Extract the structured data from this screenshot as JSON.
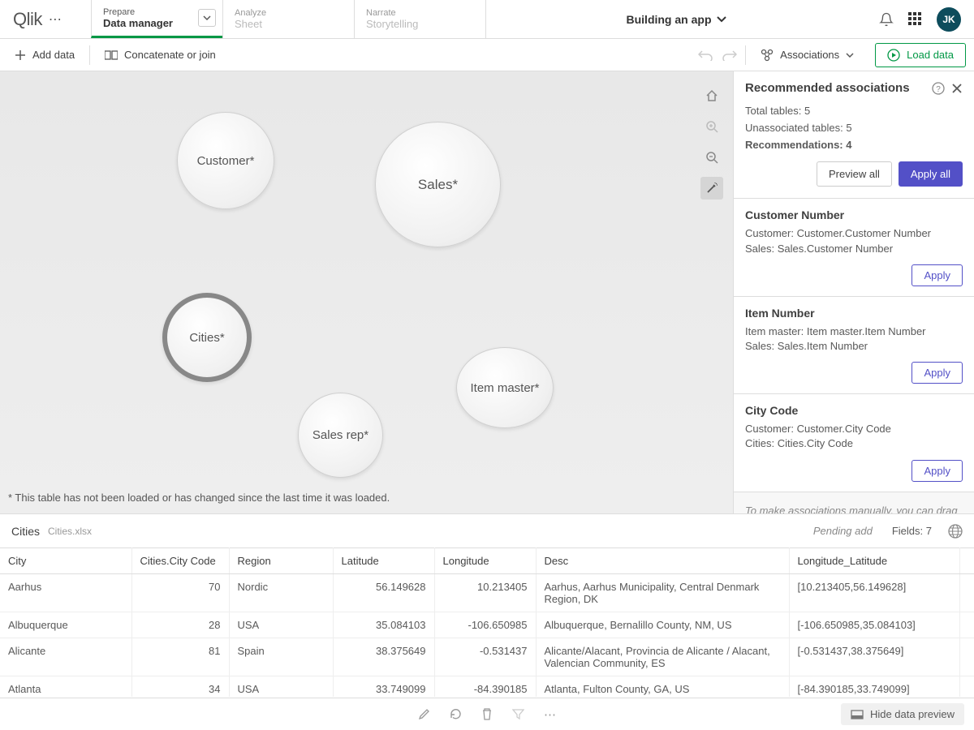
{
  "logo": "Qlik",
  "nav": {
    "prepare": {
      "top": "Prepare",
      "bottom": "Data manager"
    },
    "analyze": {
      "top": "Analyze",
      "bottom": "Sheet"
    },
    "narrate": {
      "top": "Narrate",
      "bottom": "Storytelling"
    }
  },
  "app_title": "Building an app",
  "avatar": "JK",
  "toolbar": {
    "add_data": "Add data",
    "concat": "Concatenate or join",
    "associations": "Associations",
    "load_data": "Load data"
  },
  "bubbles": {
    "customer": "Customer*",
    "sales": "Sales*",
    "cities": "Cities*",
    "item_master": "Item master*",
    "sales_rep": "Sales rep*"
  },
  "canvas_footnote": "* This table has not been loaded or has changed since the last time it was loaded.",
  "sidepanel": {
    "title": "Recommended associations",
    "total_label": "Total tables:",
    "total_value": "5",
    "unassoc_label": "Unassociated tables:",
    "unassoc_value": "5",
    "rec_label": "Recommendations:",
    "rec_value": "4",
    "preview_all": "Preview all",
    "apply_all": "Apply all",
    "recs": [
      {
        "title": "Customer Number",
        "l1": "Customer: Customer.Customer Number",
        "l2": "Sales: Sales.Customer Number",
        "apply": "Apply"
      },
      {
        "title": "Item Number",
        "l1": "Item master: Item master.Item Number",
        "l2": "Sales: Sales.Item Number",
        "apply": "Apply"
      },
      {
        "title": "City Code",
        "l1": "Customer: Customer.City Code",
        "l2": "Cities: Cities.City Code",
        "apply": "Apply"
      }
    ],
    "footer": "To make associations manually, you can drag one table onto another."
  },
  "preview": {
    "table_name": "Cities",
    "filename": "Cities.xlsx",
    "status": "Pending add",
    "fields_label": "Fields:",
    "fields_count": "7",
    "columns": [
      "City",
      "Cities.City Code",
      "Region",
      "Latitude",
      "Longitude",
      "Desc",
      "Longitude_Latitude"
    ],
    "rows": [
      [
        "Aarhus",
        "70",
        "Nordic",
        "56.149628",
        "10.213405",
        "Aarhus, Aarhus Municipality, Central Denmark Region, DK",
        "[10.213405,56.149628]"
      ],
      [
        "Albuquerque",
        "28",
        "USA",
        "35.084103",
        "-106.650985",
        "Albuquerque, Bernalillo County, NM, US",
        "[-106.650985,35.084103]"
      ],
      [
        "Alicante",
        "81",
        "Spain",
        "38.375649",
        "-0.531437",
        "Alicante/Alacant, Provincia de Alicante / Alacant, Valencian Community, ES",
        "[-0.531437,38.375649]"
      ],
      [
        "Atlanta",
        "34",
        "USA",
        "33.749099",
        "-84.390185",
        "Atlanta, Fulton County, GA, US",
        "[-84.390185,33.749099]"
      ]
    ]
  },
  "bottom": {
    "hide_preview": "Hide data preview"
  }
}
